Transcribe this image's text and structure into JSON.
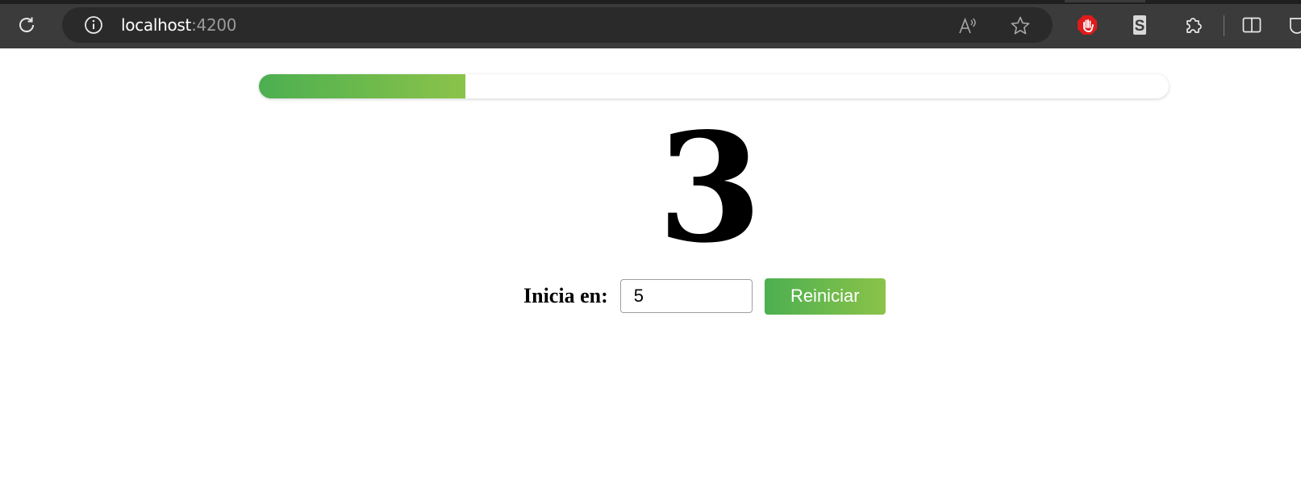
{
  "browser": {
    "url_host": "localhost",
    "url_port": ":4200"
  },
  "progress": {
    "fraction": 0.227,
    "fill_color_start": "#4caf50",
    "fill_color_end": "#8bc34a"
  },
  "counter": {
    "value": "3"
  },
  "controls": {
    "start_label": "Inicia en:",
    "start_value": "5",
    "reset_button_label": "Reiniciar"
  },
  "icons": [
    "reload-icon",
    "info-icon",
    "read-aloud-icon",
    "favorite-star-icon",
    "stop-hand-extension-icon",
    "s-extension-icon",
    "extensions-puzzle-icon",
    "split-screen-icon"
  ]
}
